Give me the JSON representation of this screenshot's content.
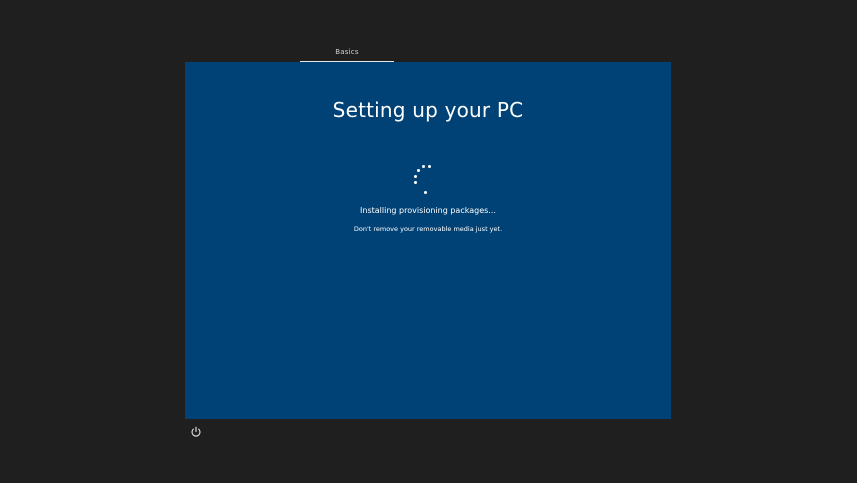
{
  "tabs": {
    "active_label": "Basics"
  },
  "setup": {
    "title": "Setting up your PC",
    "status": "Installing provisioning packages...",
    "substatus": "Don't remove your removable media just yet."
  },
  "icons": {
    "loading": "loading-spinner-icon",
    "power": "power-icon"
  },
  "colors": {
    "background": "#1f1f1f",
    "panel": "#004275",
    "text": "#ffffff"
  }
}
